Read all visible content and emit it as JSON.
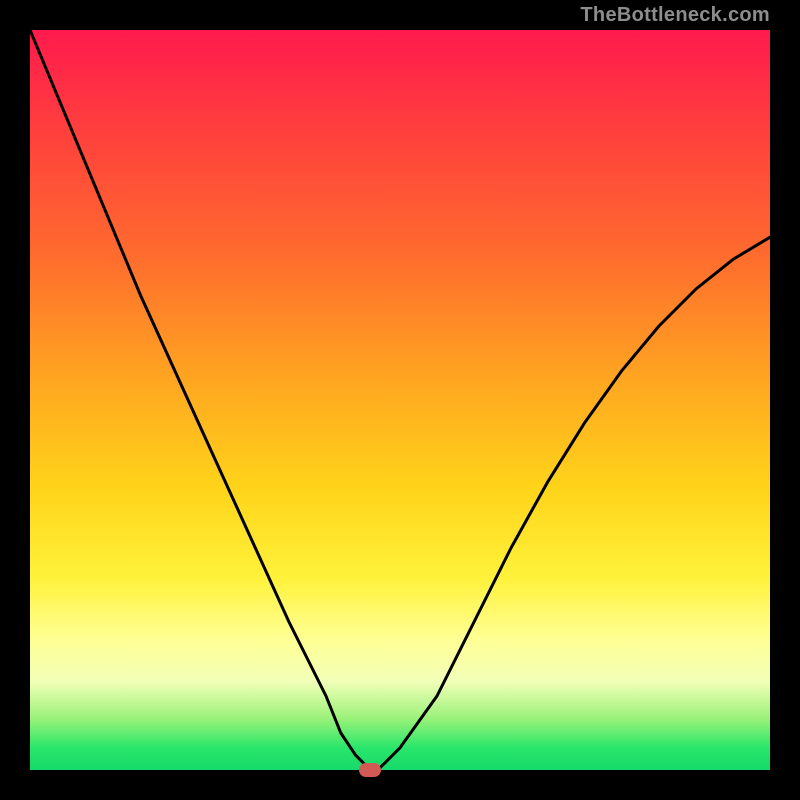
{
  "watermark": "TheBottleneck.com",
  "chart_data": {
    "type": "line",
    "title": "",
    "xlabel": "",
    "ylabel": "",
    "xlim": [
      0,
      100
    ],
    "ylim": [
      0,
      100
    ],
    "grid": false,
    "legend": false,
    "background_gradient": {
      "orientation": "vertical",
      "stops": [
        {
          "pos": 0,
          "color": "#ff1a4d"
        },
        {
          "pos": 30,
          "color": "#ff6a2e"
        },
        {
          "pos": 60,
          "color": "#ffd41a"
        },
        {
          "pos": 82,
          "color": "#ffff91"
        },
        {
          "pos": 100,
          "color": "#16d96a"
        }
      ]
    },
    "series": [
      {
        "name": "bottleneck-curve",
        "x": [
          0,
          5,
          10,
          15,
          20,
          25,
          30,
          35,
          40,
          42,
          44,
          46,
          47,
          50,
          55,
          60,
          65,
          70,
          75,
          80,
          85,
          90,
          95,
          100
        ],
        "values": [
          100,
          88,
          76,
          64,
          53,
          42,
          31,
          20,
          10,
          5,
          2,
          0,
          0,
          3,
          10,
          20,
          30,
          39,
          47,
          54,
          60,
          65,
          69,
          72
        ],
        "stroke": "#000000",
        "stroke_width": 3
      }
    ],
    "marker": {
      "x": 46,
      "y": 0,
      "color": "#d25a55"
    }
  }
}
